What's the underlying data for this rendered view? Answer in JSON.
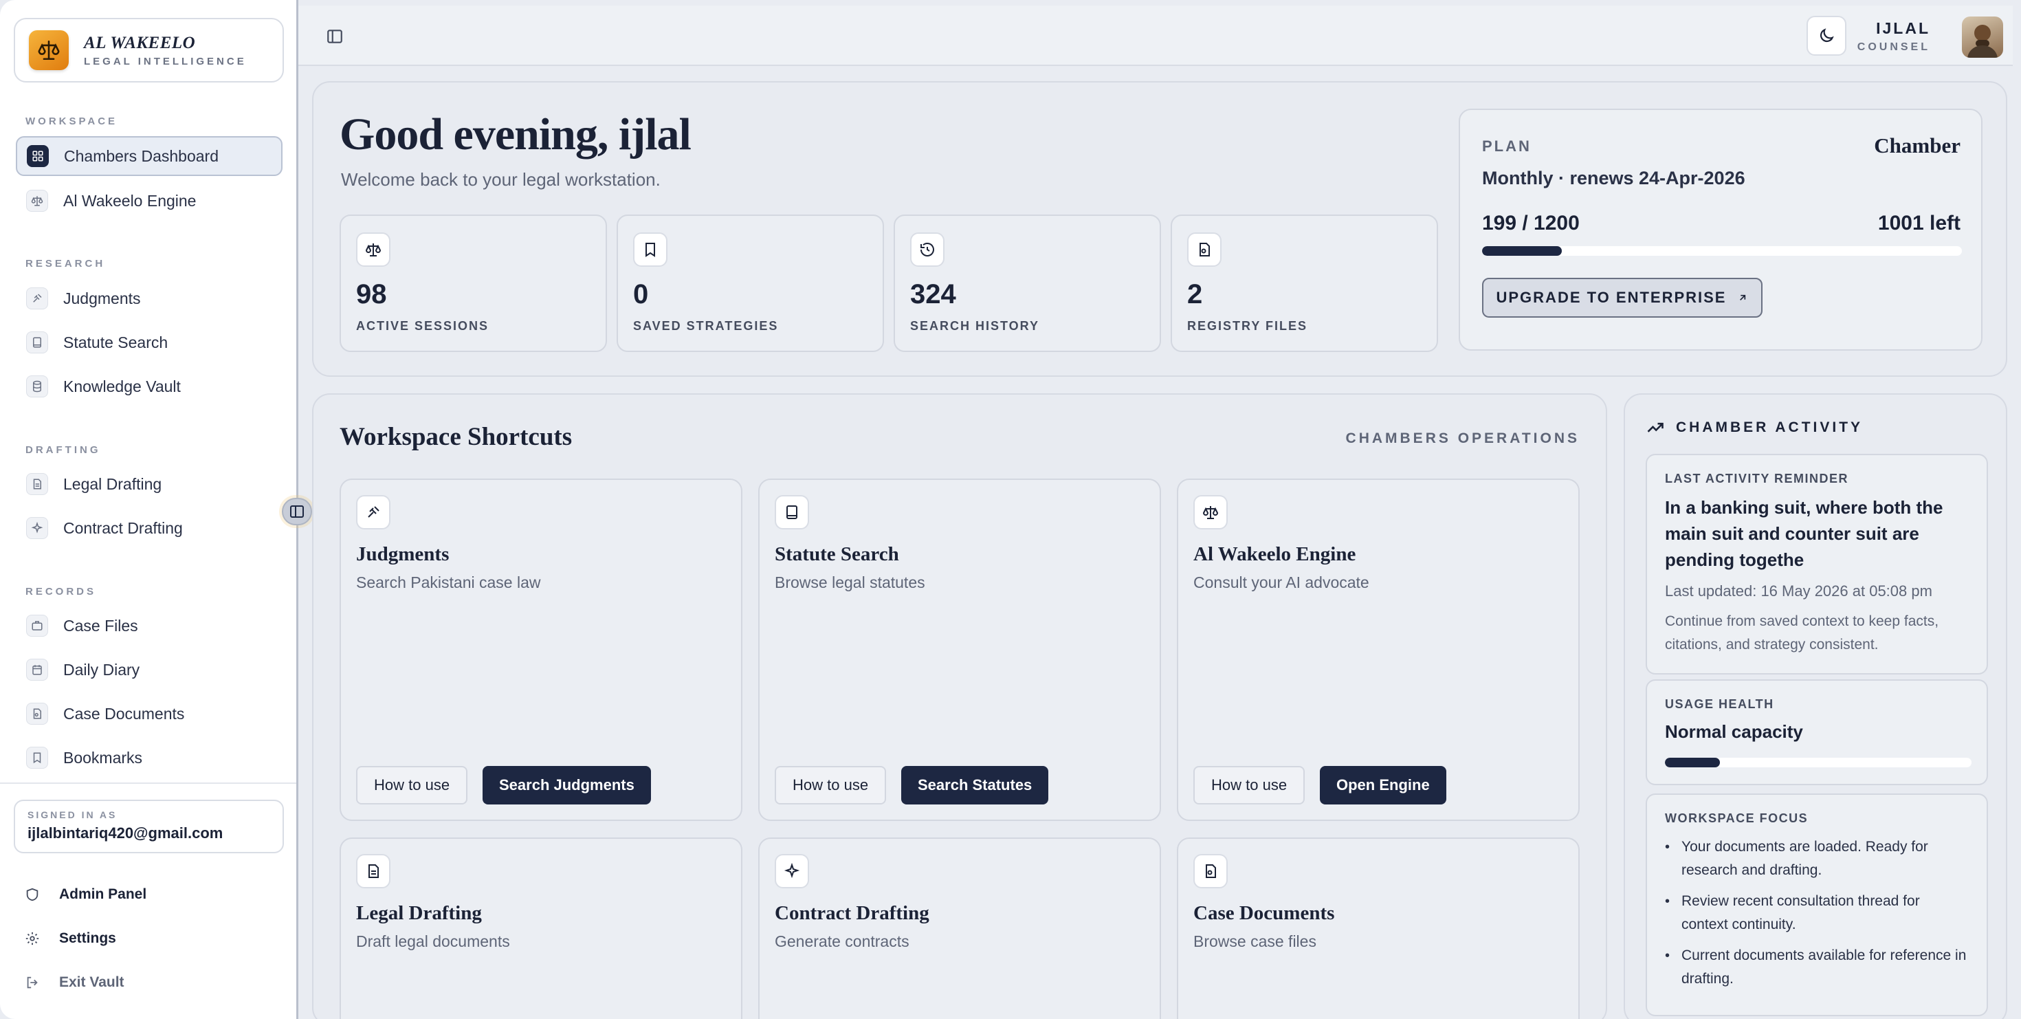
{
  "brand": {
    "name": "AL WAKEELO",
    "tagline": "LEGAL INTELLIGENCE"
  },
  "sidebar": {
    "sections": [
      {
        "label": "WORKSPACE",
        "items": [
          {
            "label": "Chambers Dashboard",
            "icon": "dashboard-icon",
            "active": true
          },
          {
            "label": "Al Wakeelo Engine",
            "icon": "scales-icon"
          }
        ]
      },
      {
        "label": "RESEARCH",
        "items": [
          {
            "label": "Judgments",
            "icon": "gavel-icon"
          },
          {
            "label": "Statute Search",
            "icon": "book-icon"
          },
          {
            "label": "Knowledge Vault",
            "icon": "database-icon"
          }
        ]
      },
      {
        "label": "DRAFTING",
        "items": [
          {
            "label": "Legal Drafting",
            "icon": "document-icon"
          },
          {
            "label": "Contract Drafting",
            "icon": "sparkle-icon"
          }
        ]
      },
      {
        "label": "RECORDS",
        "items": [
          {
            "label": "Case Files",
            "icon": "briefcase-icon"
          },
          {
            "label": "Daily Diary",
            "icon": "calendar-icon"
          },
          {
            "label": "Case Documents",
            "icon": "file-search-icon"
          },
          {
            "label": "Bookmarks",
            "icon": "bookmark-icon"
          }
        ]
      }
    ],
    "signed_in_label": "SIGNED IN AS",
    "email": "ijlalbintariq420@gmail.com",
    "footer": {
      "admin": "Admin Panel",
      "settings": "Settings",
      "exit": "Exit Vault"
    }
  },
  "topbar": {
    "user_name": "IJLAL",
    "user_role": "COUNSEL"
  },
  "hero": {
    "greeting": "Good evening, ijlal",
    "welcome": "Welcome back to your legal workstation.",
    "stats": [
      {
        "value": "98",
        "label": "ACTIVE SESSIONS",
        "icon": "scales-icon"
      },
      {
        "value": "0",
        "label": "SAVED STRATEGIES",
        "icon": "bookmark-icon"
      },
      {
        "value": "324",
        "label": "SEARCH HISTORY",
        "icon": "history-icon"
      },
      {
        "value": "2",
        "label": "REGISTRY FILES",
        "icon": "file-search-icon"
      }
    ]
  },
  "plan": {
    "label": "PLAN",
    "name": "Chamber",
    "renewal": "Monthly · renews 24-Apr-2026",
    "used_text": "199 / 1200",
    "left_text": "1001 left",
    "used_fraction": 0.166,
    "upgrade_label": "UPGRADE TO ENTERPRISE"
  },
  "shortcuts": {
    "title": "Workspace Shortcuts",
    "subtitle": "CHAMBERS OPERATIONS",
    "how_to_label": "How to use",
    "cards": [
      {
        "title": "Judgments",
        "desc": "Search Pakistani case law",
        "action": "Search Judgments",
        "icon": "gavel-icon"
      },
      {
        "title": "Statute Search",
        "desc": "Browse legal statutes",
        "action": "Search Statutes",
        "icon": "book-icon"
      },
      {
        "title": "Al Wakeelo Engine",
        "desc": "Consult your AI advocate",
        "action": "Open Engine",
        "icon": "scales-icon"
      },
      {
        "title": "Legal Drafting",
        "desc": "Draft legal documents",
        "icon": "document-icon"
      },
      {
        "title": "Contract Drafting",
        "desc": "Generate contracts",
        "icon": "sparkle-icon"
      },
      {
        "title": "Case Documents",
        "desc": "Browse case files",
        "icon": "file-search-icon"
      }
    ]
  },
  "activity": {
    "title": "CHAMBER ACTIVITY",
    "reminder_label": "LAST ACTIVITY REMINDER",
    "reminder_title": "In a banking suit, where both the main suit and counter suit are pending togethe",
    "reminder_updated": "Last updated: 16 May 2026 at 05:08 pm",
    "reminder_text": "Continue from saved context to keep facts, citations, and strategy consistent.",
    "health_label": "USAGE HEALTH",
    "health_value": "Normal capacity",
    "health_fraction": 0.18,
    "focus_label": "WORKSPACE FOCUS",
    "focus_items": [
      "Your documents are loaded. Ready for research and drafting.",
      "Review recent consultation thread for context continuity.",
      "Current documents available for reference in drafting."
    ]
  },
  "colors": {
    "accent_dark": "#1d2742",
    "brand_orange": "#f0a020",
    "background": "#e9ecf2"
  }
}
